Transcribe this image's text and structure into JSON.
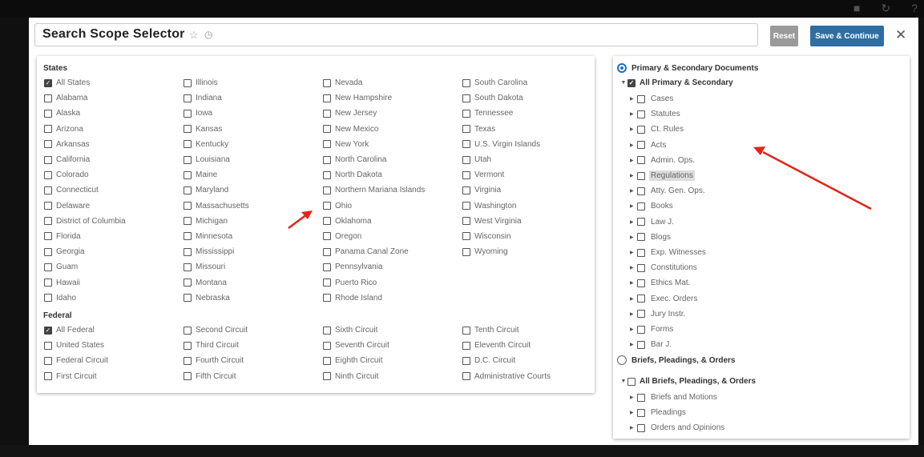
{
  "window": {
    "title": "Search Scope Selector",
    "star_icon": "star-icon",
    "history_icon": "history-icon",
    "reset_label": "Reset",
    "save_label": "Save & Continue",
    "close_label": "✕"
  },
  "states": {
    "heading": "States",
    "items": [
      {
        "label": "All States",
        "checked": true
      },
      {
        "label": "Alabama",
        "checked": false
      },
      {
        "label": "Alaska",
        "checked": false
      },
      {
        "label": "Arizona",
        "checked": false
      },
      {
        "label": "Arkansas",
        "checked": false
      },
      {
        "label": "California",
        "checked": false
      },
      {
        "label": "Colorado",
        "checked": false
      },
      {
        "label": "Connecticut",
        "checked": false
      },
      {
        "label": "Delaware",
        "checked": false
      },
      {
        "label": "District of Columbia",
        "checked": false
      },
      {
        "label": "Florida",
        "checked": false
      },
      {
        "label": "Georgia",
        "checked": false
      },
      {
        "label": "Guam",
        "checked": false
      },
      {
        "label": "Hawaii",
        "checked": false
      },
      {
        "label": "Idaho",
        "checked": false
      },
      {
        "label": "Illinois",
        "checked": false
      },
      {
        "label": "Indiana",
        "checked": false
      },
      {
        "label": "Iowa",
        "checked": false
      },
      {
        "label": "Kansas",
        "checked": false
      },
      {
        "label": "Kentucky",
        "checked": false
      },
      {
        "label": "Louisiana",
        "checked": false
      },
      {
        "label": "Maine",
        "checked": false
      },
      {
        "label": "Maryland",
        "checked": false
      },
      {
        "label": "Massachusetts",
        "checked": false
      },
      {
        "label": "Michigan",
        "checked": false
      },
      {
        "label": "Minnesota",
        "checked": false
      },
      {
        "label": "Mississippi",
        "checked": false
      },
      {
        "label": "Missouri",
        "checked": false
      },
      {
        "label": "Montana",
        "checked": false
      },
      {
        "label": "Nebraska",
        "checked": false
      },
      {
        "label": "Nevada",
        "checked": false
      },
      {
        "label": "New Hampshire",
        "checked": false
      },
      {
        "label": "New Jersey",
        "checked": false
      },
      {
        "label": "New Mexico",
        "checked": false
      },
      {
        "label": "New York",
        "checked": false
      },
      {
        "label": "North Carolina",
        "checked": false
      },
      {
        "label": "North Dakota",
        "checked": false
      },
      {
        "label": "Northern Mariana Islands",
        "checked": false
      },
      {
        "label": "Ohio",
        "checked": false
      },
      {
        "label": "Oklahoma",
        "checked": false
      },
      {
        "label": "Oregon",
        "checked": false
      },
      {
        "label": "Panama Canal Zone",
        "checked": false
      },
      {
        "label": "Pennsylvania",
        "checked": false
      },
      {
        "label": "Puerto Rico",
        "checked": false
      },
      {
        "label": "Rhode Island",
        "checked": false
      },
      {
        "label": "South Carolina",
        "checked": false
      },
      {
        "label": "South Dakota",
        "checked": false
      },
      {
        "label": "Tennessee",
        "checked": false
      },
      {
        "label": "Texas",
        "checked": false
      },
      {
        "label": "U.S. Virgin Islands",
        "checked": false
      },
      {
        "label": "Utah",
        "checked": false
      },
      {
        "label": "Vermont",
        "checked": false
      },
      {
        "label": "Virginia",
        "checked": false
      },
      {
        "label": "Washington",
        "checked": false
      },
      {
        "label": "West Virginia",
        "checked": false
      },
      {
        "label": "Wisconsin",
        "checked": false
      },
      {
        "label": "Wyoming",
        "checked": false
      }
    ]
  },
  "federal": {
    "heading": "Federal",
    "items": [
      {
        "label": "All Federal",
        "checked": true
      },
      {
        "label": "United States",
        "checked": false
      },
      {
        "label": "Federal Circuit",
        "checked": false
      },
      {
        "label": "First Circuit",
        "checked": false
      },
      {
        "label": "Second Circuit",
        "checked": false
      },
      {
        "label": "Third Circuit",
        "checked": false
      },
      {
        "label": "Fourth Circuit",
        "checked": false
      },
      {
        "label": "Fifth Circuit",
        "checked": false
      },
      {
        "label": "Sixth Circuit",
        "checked": false
      },
      {
        "label": "Seventh Circuit",
        "checked": false
      },
      {
        "label": "Eighth Circuit",
        "checked": false
      },
      {
        "label": "Ninth Circuit",
        "checked": false
      },
      {
        "label": "Tenth Circuit",
        "checked": false
      },
      {
        "label": "Eleventh Circuit",
        "checked": false
      },
      {
        "label": "D.C. Circuit",
        "checked": false
      },
      {
        "label": "Administrative Courts",
        "checked": false
      }
    ]
  },
  "doc_types": {
    "primary": {
      "label": "Primary & Secondary Documents",
      "selected": true,
      "all_label": "All Primary & Secondary",
      "all_checked": true,
      "items": [
        {
          "label": "Cases",
          "highlighted": false
        },
        {
          "label": "Statutes",
          "highlighted": false
        },
        {
          "label": "Ct. Rules",
          "highlighted": false
        },
        {
          "label": "Acts",
          "highlighted": false
        },
        {
          "label": "Admin. Ops.",
          "highlighted": false
        },
        {
          "label": "Regulations",
          "highlighted": true
        },
        {
          "label": "Atty. Gen. Ops.",
          "highlighted": false
        },
        {
          "label": "Books",
          "highlighted": false
        },
        {
          "label": "Law J.",
          "highlighted": false
        },
        {
          "label": "Blogs",
          "highlighted": false
        },
        {
          "label": "Exp. Witnesses",
          "highlighted": false
        },
        {
          "label": "Constitutions",
          "highlighted": false
        },
        {
          "label": "Ethics Mat.",
          "highlighted": false
        },
        {
          "label": "Exec. Orders",
          "highlighted": false
        },
        {
          "label": "Jury Instr.",
          "highlighted": false
        },
        {
          "label": "Forms",
          "highlighted": false
        },
        {
          "label": "Bar J.",
          "highlighted": false
        }
      ]
    },
    "briefs": {
      "label": "Briefs, Pleadings, & Orders",
      "selected": false,
      "all_label": "All Briefs, Pleadings, & Orders",
      "all_checked": false,
      "items": [
        {
          "label": "Briefs and Motions",
          "highlighted": false
        },
        {
          "label": "Pleadings",
          "highlighted": false
        },
        {
          "label": "Orders and Opinions",
          "highlighted": false
        }
      ]
    }
  },
  "annotation_color": "#e0251b"
}
